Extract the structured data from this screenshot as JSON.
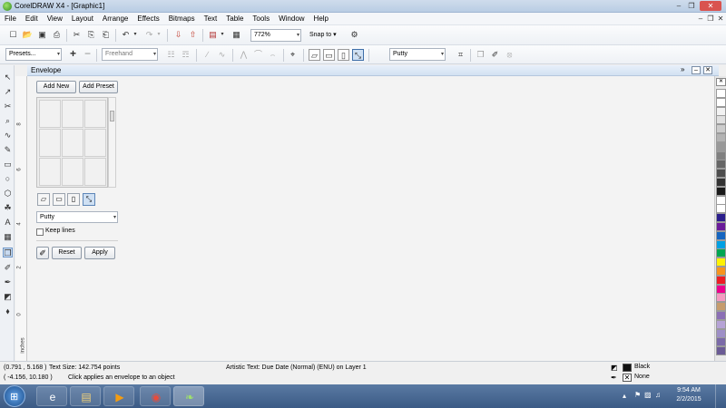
{
  "window": {
    "title": "CorelDRAW X4 - [Graphic1]"
  },
  "menu": [
    "File",
    "Edit",
    "View",
    "Layout",
    "Arrange",
    "Effects",
    "Bitmaps",
    "Text",
    "Table",
    "Tools",
    "Window",
    "Help"
  ],
  "toolbar1": {
    "zoom": "772%",
    "snap_to": "Snap to"
  },
  "toolbar2": {
    "presets": "Presets...",
    "freehand": "Freehand",
    "mode": "Putty"
  },
  "docker": {
    "title": "Envelope",
    "add_new": "Add New",
    "add_preset": "Add Preset",
    "mode_select": "Putty",
    "keep_lines": "Keep lines",
    "reset": "Reset",
    "apply": "Apply"
  },
  "ruler": {
    "label": "inches",
    "ticks": [
      "8",
      "6",
      "4",
      "2",
      "0"
    ]
  },
  "status": {
    "coords": "(0.791 , 5.168 )",
    "text_size": "Text Size: 142.754 points",
    "object_info": "Artistic Text: Due Date (Normal) (ENU) on Layer 1",
    "coords2": "( -4.156, 10.180 )",
    "hint": "Click applies an envelope to an object",
    "fill": "Black",
    "outline": "None"
  },
  "palette": [
    "#ffffff",
    "#ffffff",
    "#f2f2f2",
    "#e0e0e0",
    "#cccccc",
    "#b3b3b3",
    "#999999",
    "#808080",
    "#666666",
    "#4d4d4d",
    "#333333",
    "#1a1a1a",
    "#ffffff",
    "#ffffff",
    "#2b1e8c",
    "#6a1b9a",
    "#1565c0",
    "#00a0e3",
    "#00a651",
    "#fff200",
    "#f7941d",
    "#ed1c24",
    "#ec008c",
    "#f49ac1",
    "#c69c6d",
    "#8b6fb5",
    "#b6a3d6",
    "#9e8fc7",
    "#7b6aa8",
    "#6b5b95"
  ],
  "taskbar": {
    "time": "9:54 AM",
    "date": "2/2/2015"
  }
}
